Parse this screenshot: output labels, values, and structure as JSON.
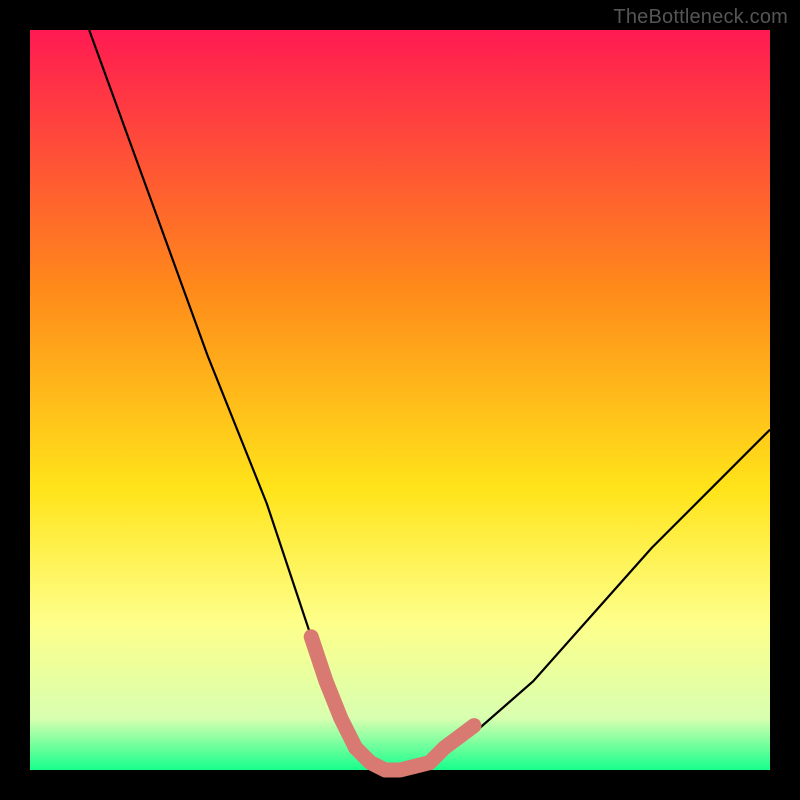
{
  "watermark": "TheBottleneck.com",
  "colors": {
    "frame": "#000000",
    "grad_top": "#ff1a52",
    "grad_mid1": "#ff8a1a",
    "grad_mid2": "#ffe41a",
    "grad_mid3": "#feff8a",
    "grad_bottom": "#17ff8c",
    "curve": "#000000",
    "marker": "#d87a71"
  },
  "chart_data": {
    "type": "line",
    "title": "",
    "xlabel": "",
    "ylabel": "",
    "xlim": [
      0,
      100
    ],
    "ylim": [
      0,
      100
    ],
    "series": [
      {
        "name": "bottleneck-curve",
        "x": [
          8,
          12,
          16,
          20,
          24,
          28,
          32,
          36,
          38,
          40,
          42,
          44,
          46,
          48,
          50,
          54,
          60,
          68,
          76,
          84,
          92,
          100
        ],
        "y": [
          100,
          89,
          78,
          67,
          56,
          46,
          36,
          24,
          18,
          12,
          7,
          3,
          1,
          0,
          0,
          1,
          5,
          12,
          21,
          30,
          38,
          46
        ]
      }
    ],
    "markers": [
      {
        "name": "left-segment",
        "x": [
          38,
          40,
          42,
          44
        ],
        "y": [
          18,
          12,
          7,
          3
        ]
      },
      {
        "name": "flat-segment",
        "x": [
          44,
          46,
          48,
          50,
          52,
          54
        ],
        "y": [
          3,
          1,
          0,
          0,
          0.5,
          1
        ]
      },
      {
        "name": "right-segment",
        "x": [
          54,
          56,
          58,
          60
        ],
        "y": [
          1,
          3,
          4.5,
          6
        ]
      }
    ],
    "gradient_stops": [
      {
        "pos": 0.0,
        "color": "#ff1a52"
      },
      {
        "pos": 0.35,
        "color": "#ff8a1a"
      },
      {
        "pos": 0.62,
        "color": "#ffe41a"
      },
      {
        "pos": 0.8,
        "color": "#feff8a"
      },
      {
        "pos": 0.93,
        "color": "#d8ffb0"
      },
      {
        "pos": 1.0,
        "color": "#17ff8c"
      }
    ]
  }
}
